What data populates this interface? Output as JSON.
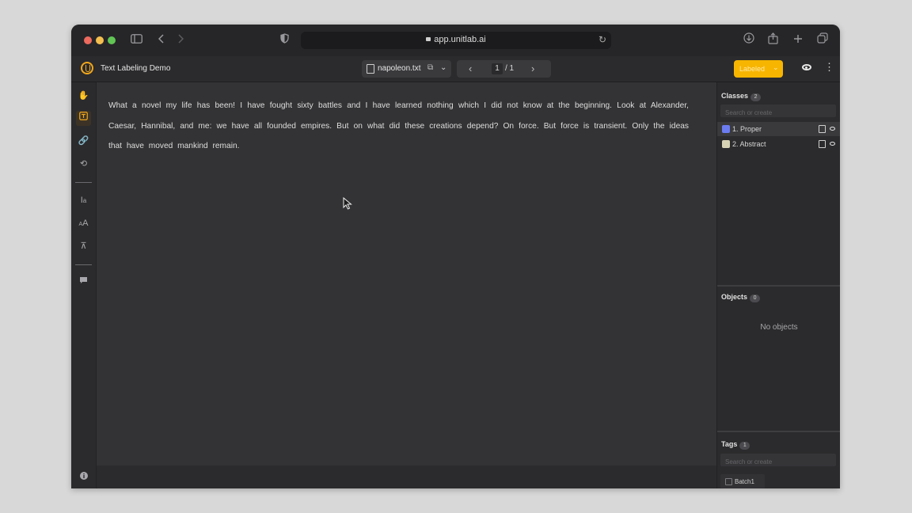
{
  "browser": {
    "url": "app.unitlab.ai"
  },
  "app": {
    "title": "Text Labeling Demo",
    "file_name": "napoleon.txt",
    "page_current": "1",
    "page_total": "/ 1",
    "label_button": "Labeled"
  },
  "document": {
    "text": "What a novel my life has been! I have fought sixty battles and I have learned nothing which I did not know at the beginning. Look at Alexander, Caesar, Hannibal, and me: we have all founded empires. But on what did these creations depend? On force. But force is transient. Only the ideas that have moved mankind remain."
  },
  "sidebar": {
    "classes": {
      "title": "Classes",
      "count": "2",
      "search_placeholder": "Search or create",
      "items": [
        {
          "label": "1. Proper",
          "color": "#6b7cf0"
        },
        {
          "label": "2. Abstract",
          "color": "#d6d1b3"
        }
      ]
    },
    "objects": {
      "title": "Objects",
      "count": "0",
      "empty_text": "No objects"
    },
    "tags": {
      "title": "Tags",
      "count": "1",
      "search_placeholder": "Search or create",
      "items": [
        {
          "label": "Batch1"
        }
      ]
    }
  },
  "icons": {
    "toolbar": [
      "hand-icon",
      "text-select-icon",
      "link-icon",
      "history-icon",
      "text-height-icon",
      "font-size-icon",
      "align-icon",
      "comment-icon",
      "info-icon"
    ],
    "accent": "#f2a71b"
  }
}
